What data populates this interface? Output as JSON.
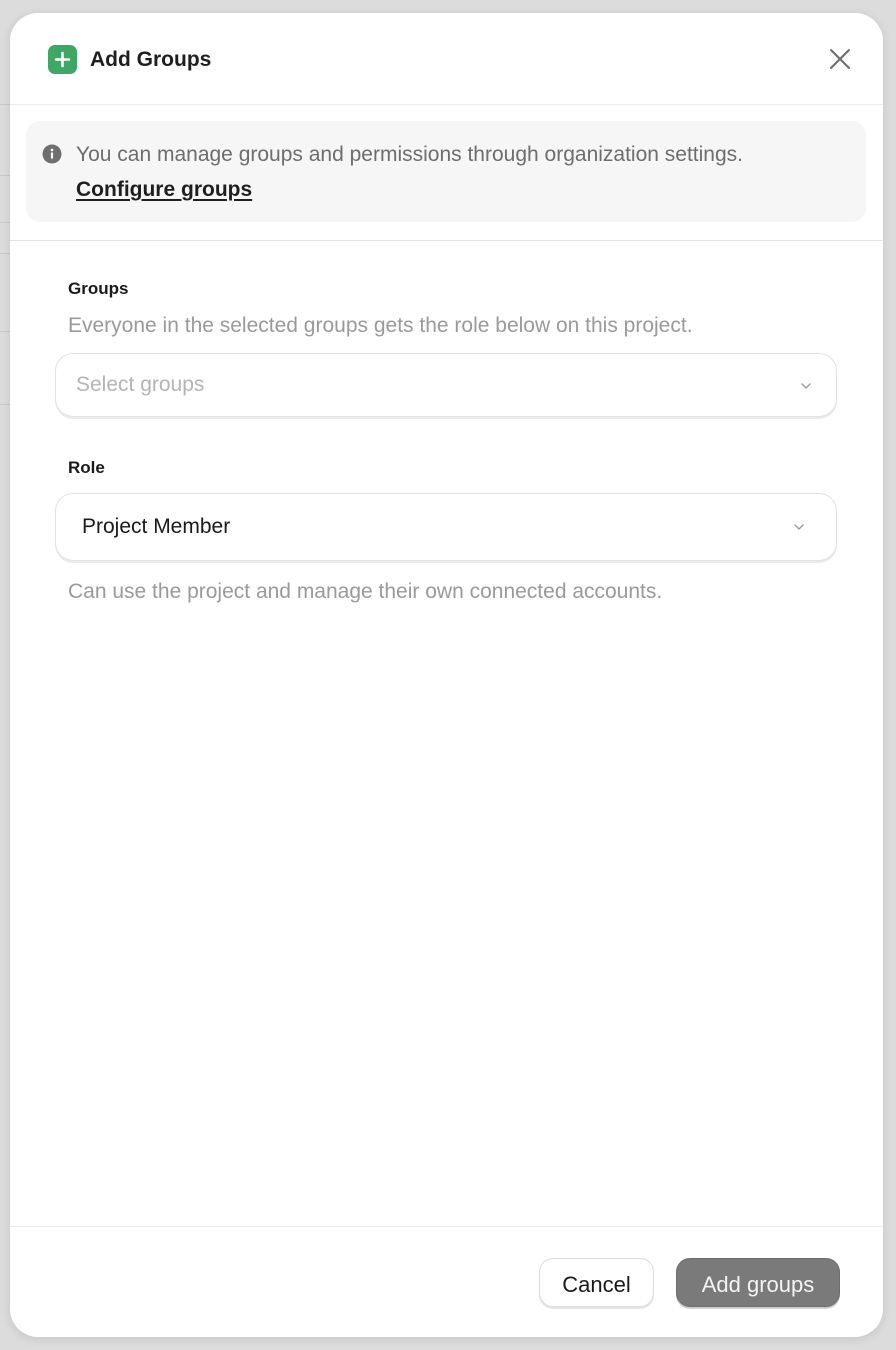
{
  "dialog": {
    "title": "Add Groups",
    "header_icon": "plus-icon",
    "close_icon": "close-icon"
  },
  "notice": {
    "icon": "info-icon",
    "text": "You can manage groups and permissions through organization settings.",
    "link_label": "Configure groups"
  },
  "groups_field": {
    "label": "Groups",
    "help": "Everyone in the selected groups gets the role below on this project.",
    "placeholder": "Select groups",
    "value": ""
  },
  "role_field": {
    "label": "Role",
    "value": "Project Member",
    "description": "Can use the project and manage their own connected accounts."
  },
  "footer": {
    "cancel_label": "Cancel",
    "submit_label": "Add groups"
  },
  "colors": {
    "accent_green": "#3fa764",
    "submit_disabled": "#7a7a7a"
  }
}
